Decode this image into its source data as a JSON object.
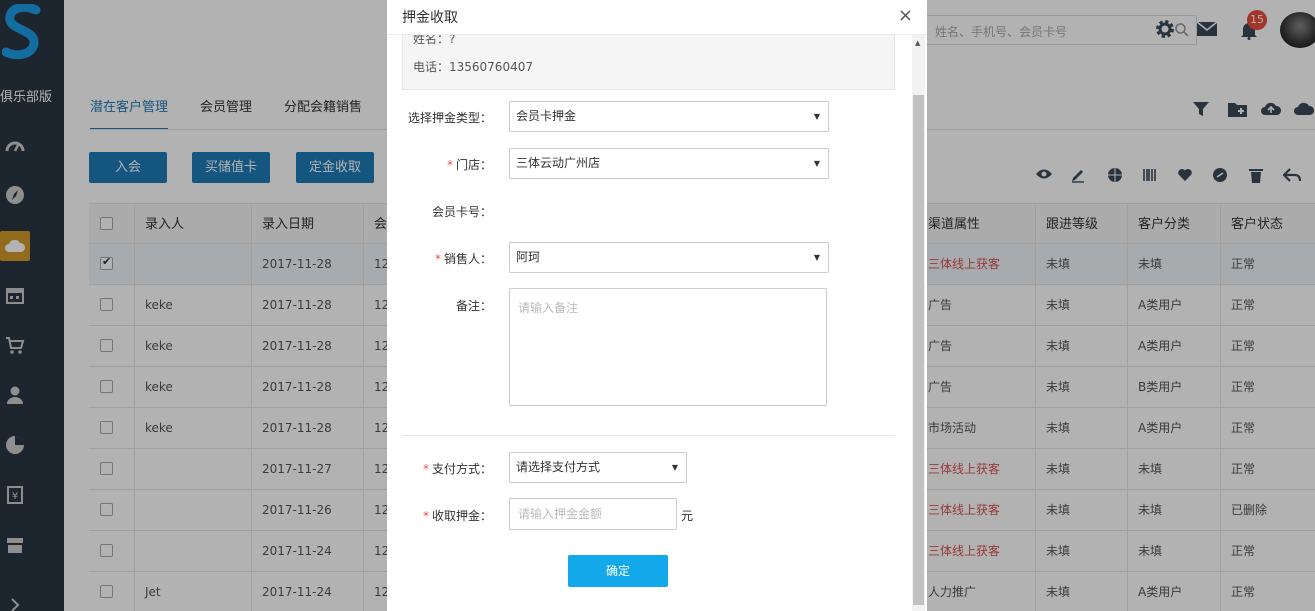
{
  "sidebar": {
    "brand": "俱乐部版",
    "icons": [
      "dashboard-icon",
      "compass-icon",
      "cloud-icon",
      "calendar-icon",
      "cart-icon",
      "user-icon",
      "pie-chart-icon",
      "money-icon",
      "store-icon",
      "chevron-right-icon"
    ]
  },
  "header": {
    "search_placeholder": "姓名、手机号、会员卡号",
    "notification_count": "15"
  },
  "tabs": [
    {
      "label": "潜在客户管理"
    },
    {
      "label": "会员管理"
    },
    {
      "label": "分配会籍销售"
    }
  ],
  "actions": {
    "join": "入会",
    "buy_card": "买储值卡",
    "deposit": "定金收取"
  },
  "table": {
    "headers": [
      "录入人",
      "录入日期",
      "会",
      "渠道属性",
      "跟进等级",
      "客户分类",
      "客户状态"
    ],
    "rows": [
      {
        "checked": true,
        "entry_by": "",
        "date": "2017-11-28",
        "c": "12",
        "channel": "三体线上获客",
        "channel_red": true,
        "level": "未填",
        "category": "未填",
        "status": "正常"
      },
      {
        "checked": false,
        "entry_by": "keke",
        "date": "2017-11-28",
        "c": "12",
        "channel": "广告",
        "channel_red": false,
        "level": "未填",
        "category": "A类用户",
        "status": "正常"
      },
      {
        "checked": false,
        "entry_by": "keke",
        "date": "2017-11-28",
        "c": "12",
        "channel": "广告",
        "channel_red": false,
        "level": "未填",
        "category": "A类用户",
        "status": "正常"
      },
      {
        "checked": false,
        "entry_by": "keke",
        "date": "2017-11-28",
        "c": "12",
        "channel": "广告",
        "channel_red": false,
        "level": "未填",
        "category": "B类用户",
        "status": "正常"
      },
      {
        "checked": false,
        "entry_by": "keke",
        "date": "2017-11-28",
        "c": "12",
        "channel": "市场活动",
        "channel_red": false,
        "level": "未填",
        "category": "A类用户",
        "status": "正常"
      },
      {
        "checked": false,
        "entry_by": "",
        "date": "2017-11-27",
        "c": "12",
        "channel": "三体线上获客",
        "channel_red": true,
        "level": "未填",
        "category": "未填",
        "status": "正常"
      },
      {
        "checked": false,
        "entry_by": "",
        "date": "2017-11-26",
        "c": "12",
        "channel": "三体线上获客",
        "channel_red": true,
        "level": "未填",
        "category": "未填",
        "status": "已删除"
      },
      {
        "checked": false,
        "entry_by": "",
        "date": "2017-11-24",
        "c": "12",
        "channel": "三体线上获客",
        "channel_red": true,
        "level": "未填",
        "category": "未填",
        "status": "正常"
      },
      {
        "checked": false,
        "entry_by": "Jet",
        "date": "2017-11-24",
        "c": "12",
        "channel": "人力推广",
        "channel_red": false,
        "level": "未填",
        "category": "A类用户",
        "status": "正常"
      }
    ]
  },
  "modal": {
    "title": "押金收取",
    "close": "×",
    "info": {
      "name_line": "姓名：?",
      "phone_line": "电话：13560760407"
    },
    "fields": {
      "deposit_type_label": "选择押金类型：",
      "deposit_type_value": "会员卡押金",
      "store_label": "门店：",
      "store_value": "三体云动广州店",
      "card_no_label": "会员卡号：",
      "sales_label": "销售人：",
      "sales_value": "阿珂",
      "remark_label": "备注：",
      "remark_placeholder": "请输入备注",
      "pay_label": "支付方式：",
      "pay_value": "请选择支付方式",
      "amount_label": "收取押金：",
      "amount_placeholder": "请输入押金金额",
      "unit": "元",
      "required_mark": "*"
    },
    "confirm": "确定"
  }
}
